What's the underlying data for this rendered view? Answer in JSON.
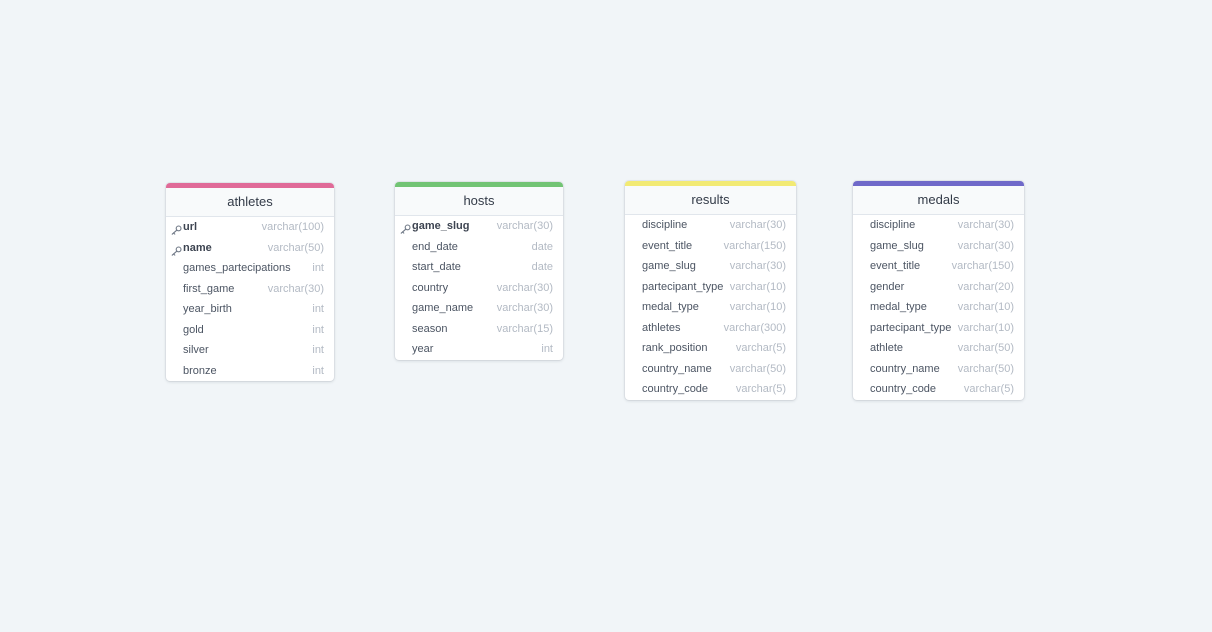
{
  "tables": [
    {
      "name": "athletes",
      "color": "#e06a98",
      "columns": [
        {
          "name": "url",
          "type": "varchar(100)",
          "pk": true
        },
        {
          "name": "name",
          "type": "varchar(50)",
          "pk": true
        },
        {
          "name": "games_partecipations",
          "type": "int",
          "pk": false
        },
        {
          "name": "first_game",
          "type": "varchar(30)",
          "pk": false
        },
        {
          "name": "year_birth",
          "type": "int",
          "pk": false
        },
        {
          "name": "gold",
          "type": "int",
          "pk": false
        },
        {
          "name": "silver",
          "type": "int",
          "pk": false
        },
        {
          "name": "bronze",
          "type": "int",
          "pk": false
        }
      ]
    },
    {
      "name": "hosts",
      "color": "#72c474",
      "columns": [
        {
          "name": "game_slug",
          "type": "varchar(30)",
          "pk": true
        },
        {
          "name": "end_date",
          "type": "date",
          "pk": false
        },
        {
          "name": "start_date",
          "type": "date",
          "pk": false
        },
        {
          "name": "country",
          "type": "varchar(30)",
          "pk": false
        },
        {
          "name": "game_name",
          "type": "varchar(30)",
          "pk": false
        },
        {
          "name": "season",
          "type": "varchar(15)",
          "pk": false
        },
        {
          "name": "year",
          "type": "int",
          "pk": false
        }
      ]
    },
    {
      "name": "results",
      "color": "#f2ea74",
      "columns": [
        {
          "name": "discipline",
          "type": "varchar(30)",
          "pk": false
        },
        {
          "name": "event_title",
          "type": "varchar(150)",
          "pk": false
        },
        {
          "name": "game_slug",
          "type": "varchar(30)",
          "pk": false
        },
        {
          "name": "partecipant_type",
          "type": "varchar(10)",
          "pk": false
        },
        {
          "name": "medal_type",
          "type": "varchar(10)",
          "pk": false
        },
        {
          "name": "athletes",
          "type": "varchar(300)",
          "pk": false
        },
        {
          "name": "rank_position",
          "type": "varchar(5)",
          "pk": false
        },
        {
          "name": "country_name",
          "type": "varchar(50)",
          "pk": false
        },
        {
          "name": "country_code",
          "type": "varchar(5)",
          "pk": false
        }
      ]
    },
    {
      "name": "medals",
      "color": "#6f69c9",
      "columns": [
        {
          "name": "discipline",
          "type": "varchar(30)",
          "pk": false
        },
        {
          "name": "game_slug",
          "type": "varchar(30)",
          "pk": false
        },
        {
          "name": "event_title",
          "type": "varchar(150)",
          "pk": false
        },
        {
          "name": "gender",
          "type": "varchar(20)",
          "pk": false
        },
        {
          "name": "medal_type",
          "type": "varchar(10)",
          "pk": false
        },
        {
          "name": "partecipant_type",
          "type": "varchar(10)",
          "pk": false
        },
        {
          "name": "athlete",
          "type": "varchar(50)",
          "pk": false
        },
        {
          "name": "country_name",
          "type": "varchar(50)",
          "pk": false
        },
        {
          "name": "country_code",
          "type": "varchar(5)",
          "pk": false
        }
      ]
    }
  ]
}
